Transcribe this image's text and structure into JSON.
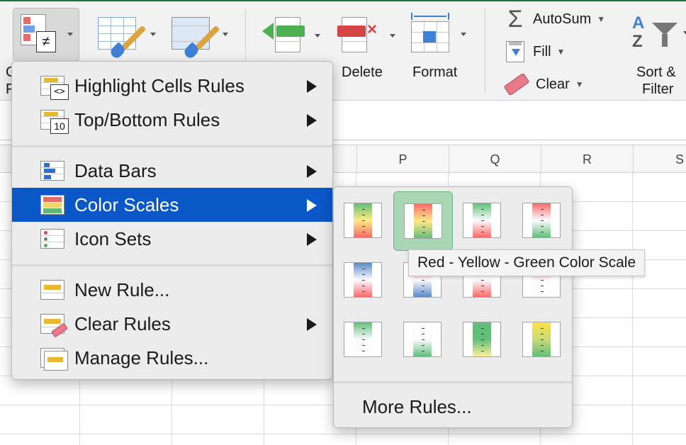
{
  "ribbon": {
    "conditional_formatting_label_partial": "C",
    "conditional_formatting_label_partial2": "F",
    "delete_label": "Delete",
    "format_label": "Format",
    "autosum_label": "AutoSum",
    "fill_label": "Fill",
    "clear_label": "Clear",
    "sort_filter_line1": "Sort &",
    "sort_filter_line2": "Filter",
    "sort_icon_letters_top": "A",
    "sort_icon_letters_bottom": "Z",
    "sigma": "Σ"
  },
  "sheet": {
    "columns": [
      "P",
      "Q",
      "R",
      "S"
    ]
  },
  "menu": {
    "items": [
      {
        "label": "Highlight Cells Rules",
        "icon": "highlight-cells-icon",
        "icon_text": "<>",
        "has_submenu": true
      },
      {
        "label": "Top/Bottom Rules",
        "icon": "top-bottom-icon",
        "icon_text": "10",
        "has_submenu": true
      },
      {
        "label": "Data Bars",
        "icon": "data-bars-icon",
        "has_submenu": true
      },
      {
        "label": "Color Scales",
        "icon": "color-scales-icon",
        "has_submenu": true,
        "selected": true
      },
      {
        "label": "Icon Sets",
        "icon": "icon-sets-icon",
        "has_submenu": true
      },
      {
        "label": "New Rule...",
        "icon": "new-rule-icon",
        "has_submenu": false
      },
      {
        "label": "Clear Rules",
        "icon": "clear-rules-icon",
        "has_submenu": true
      },
      {
        "label": "Manage Rules...",
        "icon": "manage-rules-icon",
        "has_submenu": false
      }
    ]
  },
  "submenu": {
    "swatches": [
      {
        "name": "green-yellow-red",
        "colors": [
          "#63be7b",
          "#ffeb84",
          "#f8696b"
        ]
      },
      {
        "name": "red-yellow-green",
        "colors": [
          "#f8696b",
          "#ffeb84",
          "#63be7b"
        ],
        "active": true
      },
      {
        "name": "green-white-red",
        "colors": [
          "#63be7b",
          "#fcfcff",
          "#f8696b"
        ]
      },
      {
        "name": "red-white-green",
        "colors": [
          "#f8696b",
          "#fcfcff",
          "#63be7b"
        ]
      },
      {
        "name": "blue-white-red",
        "colors": [
          "#5a8ac6",
          "#fcfcff",
          "#f8696b"
        ]
      },
      {
        "name": "red-white-blue",
        "colors": [
          "#f8696b",
          "#fcfcff",
          "#5a8ac6"
        ]
      },
      {
        "name": "white-red",
        "colors": [
          "#fcfcff",
          "#fcfcff",
          "#f8696b"
        ]
      },
      {
        "name": "red-white",
        "colors": [
          "#f8696b",
          "#fcfcff",
          "#fcfcff"
        ]
      },
      {
        "name": "green-white",
        "colors": [
          "#63be7b",
          "#fcfcff",
          "#fcfcff"
        ]
      },
      {
        "name": "white-green",
        "colors": [
          "#fcfcff",
          "#fcfcff",
          "#63be7b"
        ]
      },
      {
        "name": "green-yellow",
        "colors": [
          "#63be7b",
          "#63be7b",
          "#ffef9c"
        ]
      },
      {
        "name": "yellow-green",
        "colors": [
          "#ffe04a",
          "#c9db7a",
          "#63be7b"
        ]
      }
    ],
    "more_rules_label": "More Rules...",
    "tooltip": "Red - Yellow - Green Color Scale"
  },
  "colors": {
    "selection_blue": "#0a57c7",
    "excel_green": "#1e7145",
    "active_swatch_bg": "#a9d7b6"
  }
}
